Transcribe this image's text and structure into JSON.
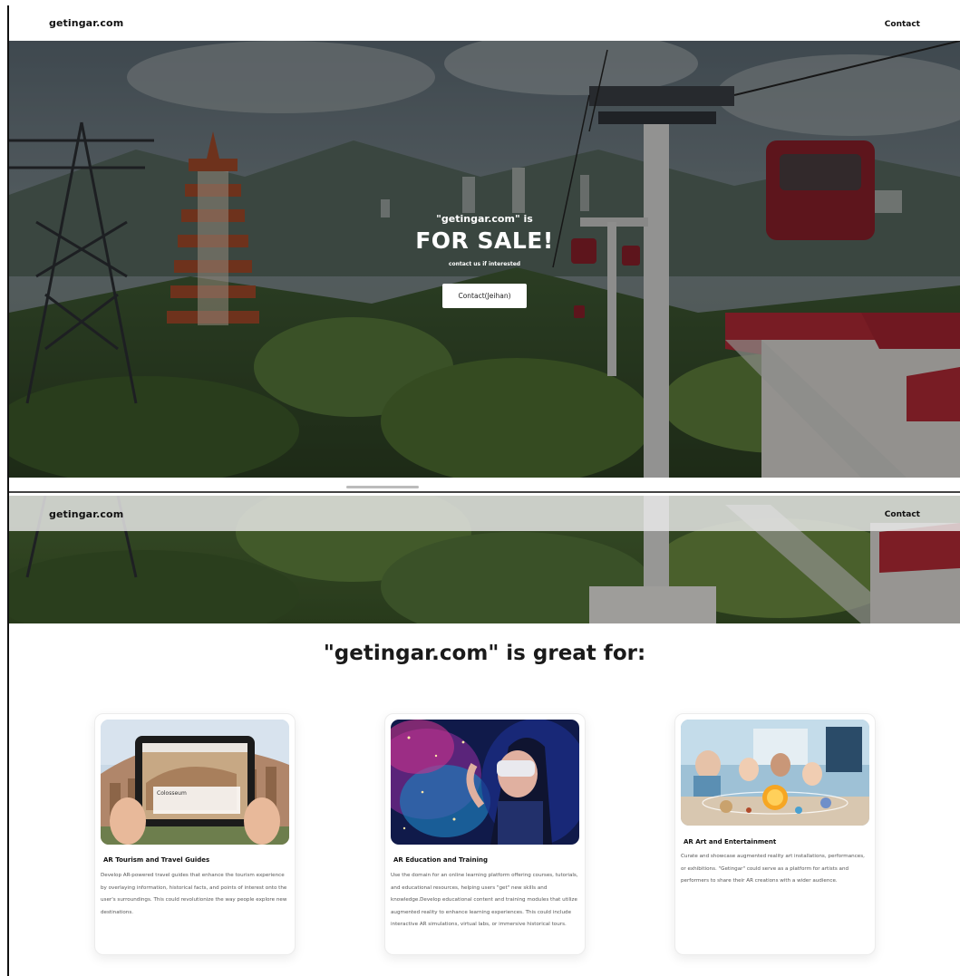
{
  "site": {
    "brand": "getingar.com",
    "nav_contact": "Contact"
  },
  "hero": {
    "prefix": "\"getingar.com\" is",
    "title": "FOR SALE!",
    "subtitle": "contact us if interested",
    "button_label": "Contact(Jeihan)"
  },
  "features": {
    "heading": "\"getingar.com\" is great for:",
    "cards": [
      {
        "title": "AR Tourism and Travel Guides",
        "text": "Develop AR-powered travel guides that enhance the tourism experience by overlaying information, historical facts, and points of interest onto the user's surroundings. This could revolutionize the way people explore new destinations.",
        "image": "colosseum-tablet-ar",
        "screen_label": "Colosseum"
      },
      {
        "title": "AR Education and Training",
        "text": "Use the domain for an online learning platform offering courses, tutorials, and educational resources, helping users \"get\" new skills and knowledge.Develop educational content and training modules that utilize augmented reality to enhance learning experiences. This could include interactive AR simulations, virtual labs, or immersive historical tours.",
        "image": "woman-vr-headset"
      },
      {
        "title": "AR Art and Entertainment",
        "text": "Curate and showcase augmented reality art installations, performances, or exhibitions. \"Getingar\" could serve as a platform for artists and performers to share their AR creations with a wider audience.",
        "image": "kids-classroom-solar-system"
      }
    ]
  },
  "colors": {
    "hero_overlay": "#000000",
    "button_bg": "#ffffff",
    "heading_text": "#1a1a1a"
  }
}
